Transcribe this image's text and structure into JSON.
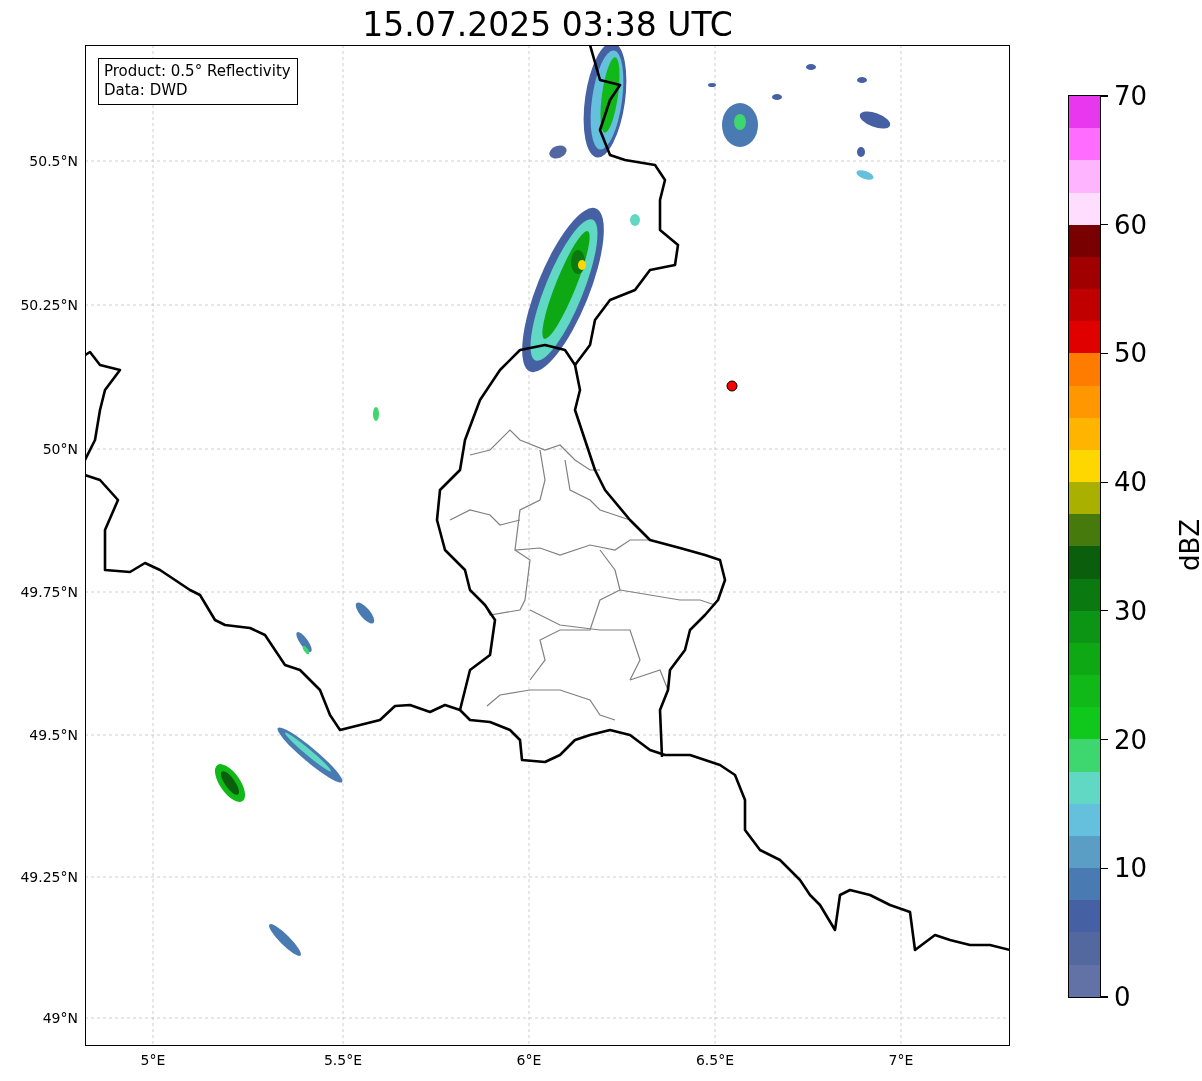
{
  "title": "15.07.2025 03:38 UTC",
  "legend": {
    "lines": [
      "Product: 0.5° Reflectivity",
      "Data: DWD"
    ]
  },
  "map": {
    "y_ticks": [
      "50.5°N",
      "50.25°N",
      "50°N",
      "49.75°N",
      "49.5°N",
      "49.25°N",
      "49°N"
    ],
    "x_ticks": [
      "5°E",
      "5.5°E",
      "6°E",
      "6.5°E",
      "7°E"
    ]
  },
  "colorbar": {
    "label": "dBZ",
    "ticks": [
      "70",
      "60",
      "50",
      "40",
      "30",
      "20",
      "10",
      "0"
    ],
    "segments": [
      {
        "color": "#e838ee"
      },
      {
        "color": "#ff6cff"
      },
      {
        "color": "#ffb4ff"
      },
      {
        "color": "#ffddff"
      },
      {
        "color": "#780000"
      },
      {
        "color": "#a00000"
      },
      {
        "color": "#c00000"
      },
      {
        "color": "#e00000"
      },
      {
        "color": "#ff7c00"
      },
      {
        "color": "#ff9800"
      },
      {
        "color": "#ffb400"
      },
      {
        "color": "#ffd700"
      },
      {
        "color": "#aab000"
      },
      {
        "color": "#467a0c"
      },
      {
        "color": "#0a5e0c"
      },
      {
        "color": "#0a7a10"
      },
      {
        "color": "#0c9414"
      },
      {
        "color": "#0ea814"
      },
      {
        "color": "#10b818"
      },
      {
        "color": "#10c81c"
      },
      {
        "color": "#3ed66e"
      },
      {
        "color": "#60d8c4"
      },
      {
        "color": "#64c0dc"
      },
      {
        "color": "#5a9ec6"
      },
      {
        "color": "#4a7ab2"
      },
      {
        "color": "#4660a4"
      },
      {
        "color": "#5468a0"
      },
      {
        "color": "#6272a6"
      }
    ]
  }
}
